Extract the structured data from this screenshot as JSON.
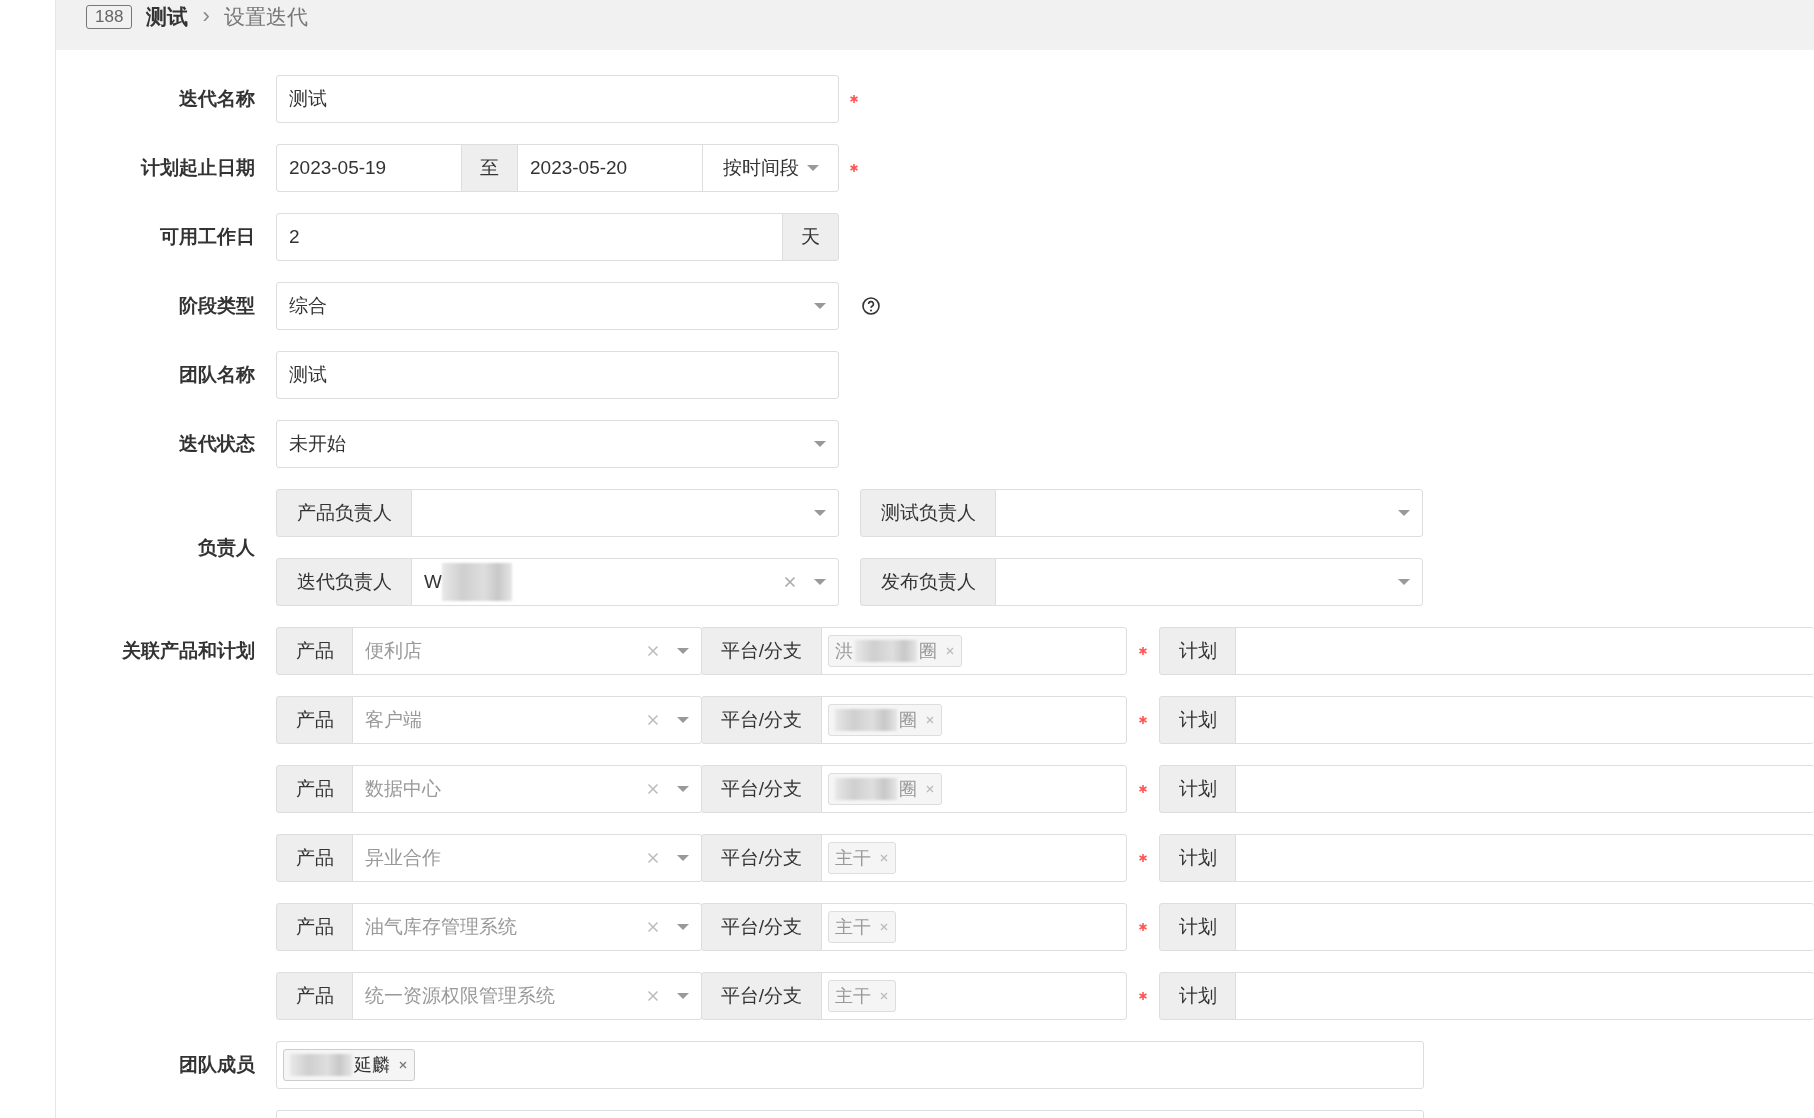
{
  "breadcrumb": {
    "badge": "188",
    "project": "测试",
    "separator": "›",
    "page": "设置迭代"
  },
  "form": {
    "name": {
      "label": "迭代名称",
      "value": "测试",
      "required": true
    },
    "dates": {
      "label": "计划起止日期",
      "start": "2023-05-19",
      "joiner": "至",
      "end": "2023-05-20",
      "mode": "按时间段",
      "required": true
    },
    "workdays": {
      "label": "可用工作日",
      "value": "2",
      "unit": "天"
    },
    "stage_type": {
      "label": "阶段类型",
      "value": "综合"
    },
    "team_name": {
      "label": "团队名称",
      "value": "测试"
    },
    "status": {
      "label": "迭代状态",
      "value": "未开始"
    },
    "owners": {
      "label": "负责人",
      "items": [
        {
          "label": "产品负责人",
          "clearable": false
        },
        {
          "label": "测试负责人",
          "clearable": false
        },
        {
          "label": "迭代负责人",
          "value": "W",
          "redacted": true,
          "clearable": true
        },
        {
          "label": "发布负责人",
          "clearable": false
        }
      ]
    },
    "products": {
      "label": "关联产品和计划",
      "rows": [
        {
          "product_label": "产品",
          "product": "便利店",
          "branch_label": "平台/分支",
          "branch": {
            "prefix": "洪",
            "suffix": "圈",
            "redacted": true
          },
          "plan_label": "计划",
          "required": true
        },
        {
          "product_label": "产品",
          "product": "客户端",
          "branch_label": "平台/分支",
          "branch": {
            "suffix": "圈",
            "redacted": true
          },
          "plan_label": "计划",
          "required": true
        },
        {
          "product_label": "产品",
          "product": "数据中心",
          "branch_label": "平台/分支",
          "branch": {
            "suffix": "圈",
            "redacted": true
          },
          "plan_label": "计划",
          "required": true
        },
        {
          "product_label": "产品",
          "product": "异业合作",
          "branch_label": "平台/分支",
          "branch": {
            "prefix": "主干",
            "redacted": false
          },
          "plan_label": "计划",
          "required": true
        },
        {
          "product_label": "产品",
          "product": "油气库存管理系统",
          "branch_label": "平台/分支",
          "branch": {
            "prefix": "主干",
            "redacted": false
          },
          "plan_label": "计划",
          "required": true
        },
        {
          "product_label": "产品",
          "product": "统一资源权限管理系统",
          "branch_label": "平台/分支",
          "branch": {
            "prefix": "主干",
            "redacted": false
          },
          "plan_label": "计划",
          "required": true
        }
      ]
    },
    "members": {
      "label": "团队成员",
      "tags": [
        {
          "text": "延麟",
          "redacted": true
        }
      ]
    }
  }
}
